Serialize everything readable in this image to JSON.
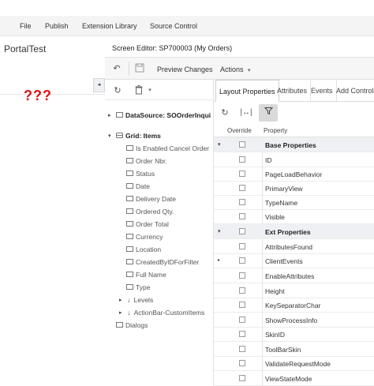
{
  "menu": {
    "file": "File",
    "publish": "Publish",
    "extension_library": "Extension Library",
    "source_control": "Source Control"
  },
  "left_pane": {
    "title": "PortalTest",
    "placeholder": "???",
    "collapse_glyph": "◂"
  },
  "editor": {
    "title": "Screen Editor: SP700003 (My Orders)"
  },
  "toolbar": {
    "preview_changes": "Preview Changes",
    "actions": "Actions",
    "actions_caret": "▾"
  },
  "tree": {
    "datasource": "DataSource: SOOrderInqui",
    "grid": "Grid: Items",
    "fields": [
      "Is Enabled Cancel Order",
      "Order Nbr.",
      "Status",
      "Date",
      "Delivery Date",
      "Ordered Qty.",
      "Order Total",
      "Currency",
      "Location",
      "CreatedByIDForFilter",
      "Full Name",
      "Type"
    ],
    "levels": "Levels",
    "actionbar": "ActionBar-CustomItems",
    "dialogs": "Dialogs"
  },
  "tabs": {
    "layout_properties": "Layout Properties",
    "attributes": "Attributes",
    "events": "Events",
    "add_controls": "Add Controls"
  },
  "grid_headers": {
    "override": "Override",
    "property": "Property"
  },
  "groups": {
    "base": "Base Properties",
    "ext": "Ext Properties"
  },
  "base_properties": [
    "ID",
    "PageLoadBehavior",
    "PrimaryView",
    "TypeName",
    "Visible"
  ],
  "ext_properties": [
    "AttributesFound",
    "ClientEvents",
    "EnableAttributes",
    "Height",
    "KeySeparatorChar",
    "ShowProcessInfo",
    "SkinID",
    "ToolBarSkin",
    "ValidateRequestMode",
    "ViewStateMode"
  ]
}
